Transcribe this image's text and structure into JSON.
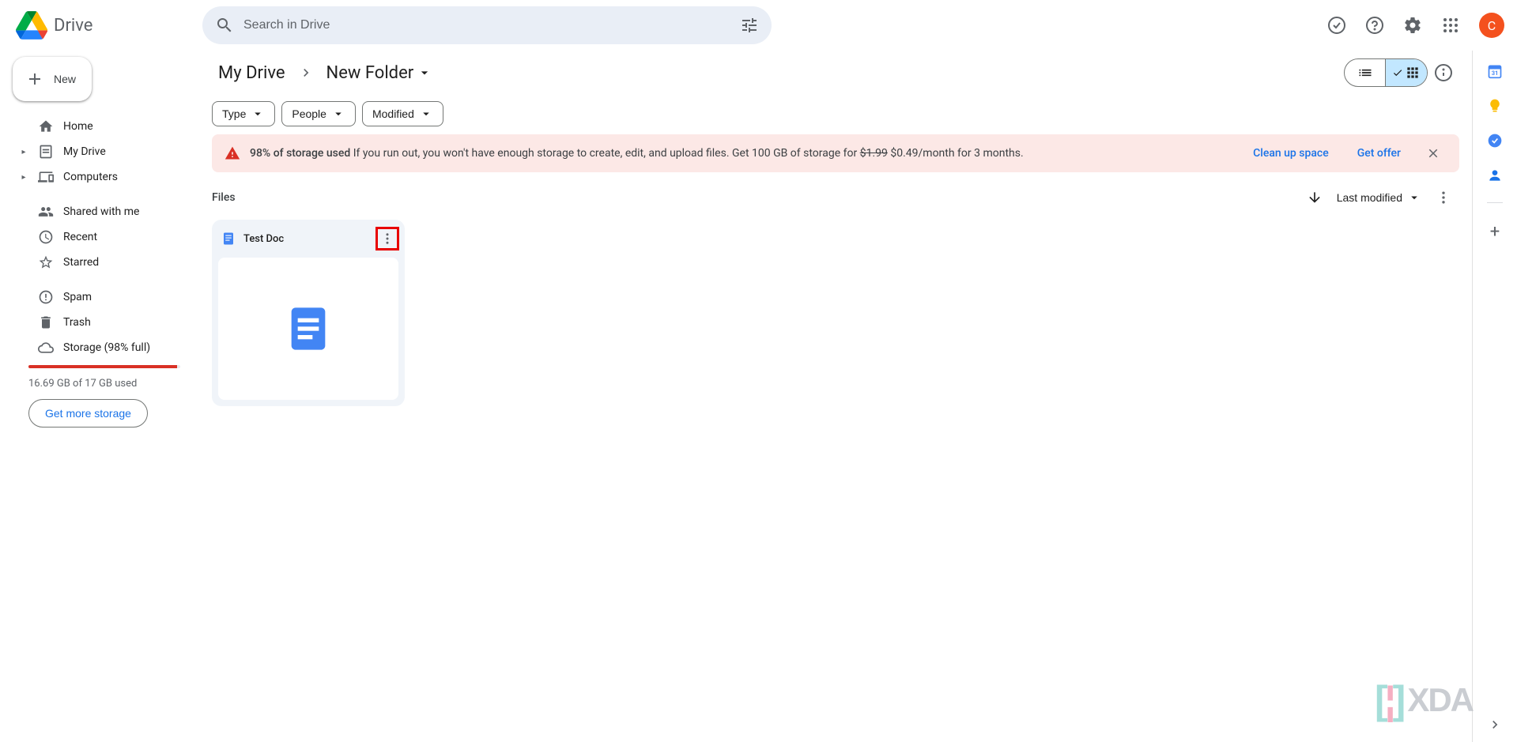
{
  "app": {
    "title": "Drive"
  },
  "search": {
    "placeholder": "Search in Drive"
  },
  "header": {
    "avatar_initial": "C"
  },
  "sidebar": {
    "new_label": "New",
    "items": [
      {
        "label": "Home",
        "icon": "home",
        "expandable": false
      },
      {
        "label": "My Drive",
        "icon": "drive",
        "expandable": true
      },
      {
        "label": "Computers",
        "icon": "computers",
        "expandable": true
      }
    ],
    "items2": [
      {
        "label": "Shared with me",
        "icon": "shared"
      },
      {
        "label": "Recent",
        "icon": "recent"
      },
      {
        "label": "Starred",
        "icon": "starred"
      }
    ],
    "items3": [
      {
        "label": "Spam",
        "icon": "spam"
      },
      {
        "label": "Trash",
        "icon": "trash"
      },
      {
        "label": "Storage (98% full)",
        "icon": "cloud"
      }
    ],
    "storage_percent": 98,
    "storage_text": "16.69 GB of 17 GB used",
    "get_storage_label": "Get more storage"
  },
  "breadcrumb": {
    "root": "My Drive",
    "current": "New Folder"
  },
  "filters": {
    "type": "Type",
    "people": "People",
    "modified": "Modified"
  },
  "banner": {
    "bold": "98% of storage used",
    "text_prefix": "If you run out, you won't have enough storage to create, edit, and upload files. Get 100 GB of storage for ",
    "old_price": "$1.99",
    "new_price": " $0.49/month for 3 months.",
    "clean_up": "Clean up space",
    "get_offer": "Get offer"
  },
  "section": {
    "title": "Files",
    "sort_label": "Last modified"
  },
  "files": [
    {
      "name": "Test Doc",
      "type": "docs"
    }
  ],
  "watermark": {
    "text": "XDA"
  }
}
